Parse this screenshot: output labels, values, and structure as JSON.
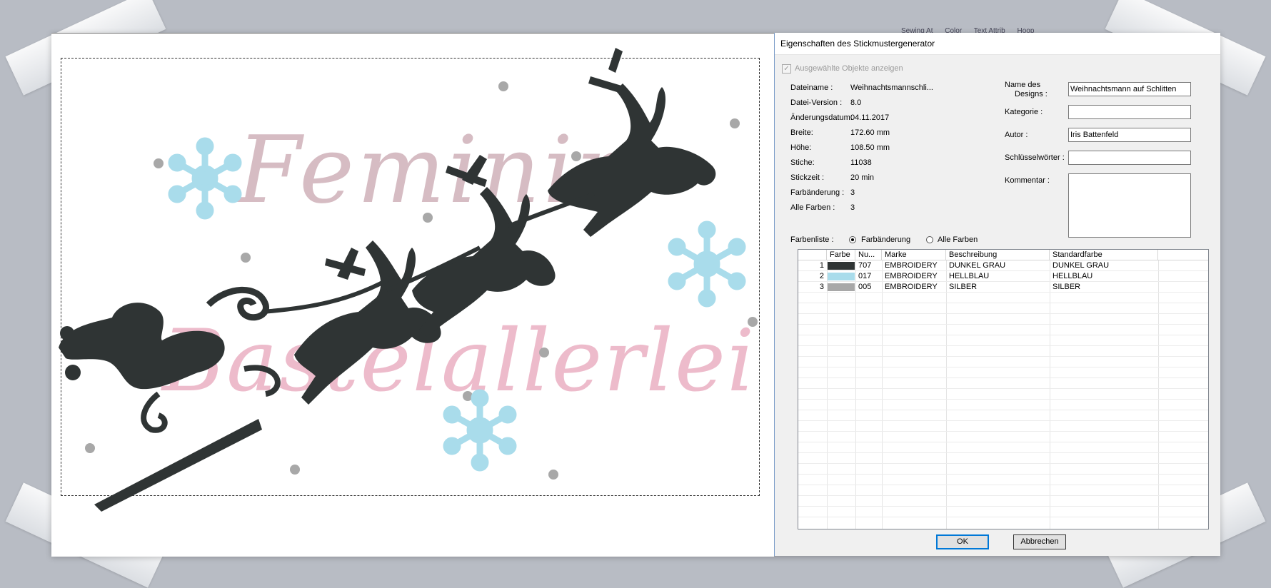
{
  "toolbar": {
    "items": [
      "Sewing At",
      "Color",
      "Text Attrib",
      "Hoop"
    ]
  },
  "dialog": {
    "title": "Eigenschaften des Stickmustergenerator",
    "show_selected_label": "Ausgewählte Objekte anzeigen",
    "show_selected_checked": true,
    "info": [
      {
        "label": "Dateiname :",
        "value": "Weihnachtsmannschli..."
      },
      {
        "label": "Datei-Version :",
        "value": "8.0"
      },
      {
        "label": "Änderungsdatum:",
        "value": "04.11.2017"
      },
      {
        "label": "Breite:",
        "value": "172.60 mm"
      },
      {
        "label": "Höhe:",
        "value": "108.50 mm"
      },
      {
        "label": "Stiche:",
        "value": "11038"
      },
      {
        "label": "Stickzeit :",
        "value": "20 min"
      },
      {
        "label": "Farbänderung :",
        "value": "3"
      },
      {
        "label": "Alle Farben :",
        "value": "3"
      }
    ],
    "fields": {
      "name_label_1": "Name des",
      "name_label_2": "Designs :",
      "name_value": "Weihnachtsmann auf Schlitten",
      "category_label": "Kategorie :",
      "category_value": "",
      "author_label": "Autor :",
      "author_value": "Iris Battenfeld",
      "keywords_label": "Schlüsselwörter :",
      "keywords_value": "",
      "comment_label": "Kommentar :",
      "comment_value": ""
    },
    "color_list": {
      "label": "Farbenliste :",
      "option_changes": "Farbänderung",
      "option_all": "Alle Farben",
      "selected": "Farbänderung",
      "columns": [
        "",
        "Farbe",
        "Nu...",
        "Marke",
        "Beschreibung",
        "Standardfarbe"
      ],
      "rows": [
        {
          "index": "1",
          "color": "#2f3434",
          "number": "707",
          "brand": "EMBROIDERY",
          "description": "DUNKEL GRAU",
          "standard": "DUNKEL GRAU"
        },
        {
          "index": "2",
          "color": "#a9dceb",
          "number": "017",
          "brand": "EMBROIDERY",
          "description": "HELLBLAU",
          "standard": "HELLBLAU"
        },
        {
          "index": "3",
          "color": "#a8a8a8",
          "number": "005",
          "brand": "EMBROIDERY",
          "description": "SILBER",
          "standard": "SILBER"
        }
      ]
    },
    "ok_label": "OK",
    "cancel_label": "Abbrechen"
  },
  "design": {
    "watermark_line1": "Feminin",
    "watermark_line2": "Bastelallerlei",
    "thread_colors": {
      "dark": "#2f3434",
      "light_blue": "#a9dceb",
      "silver": "#a8a8a8"
    }
  }
}
